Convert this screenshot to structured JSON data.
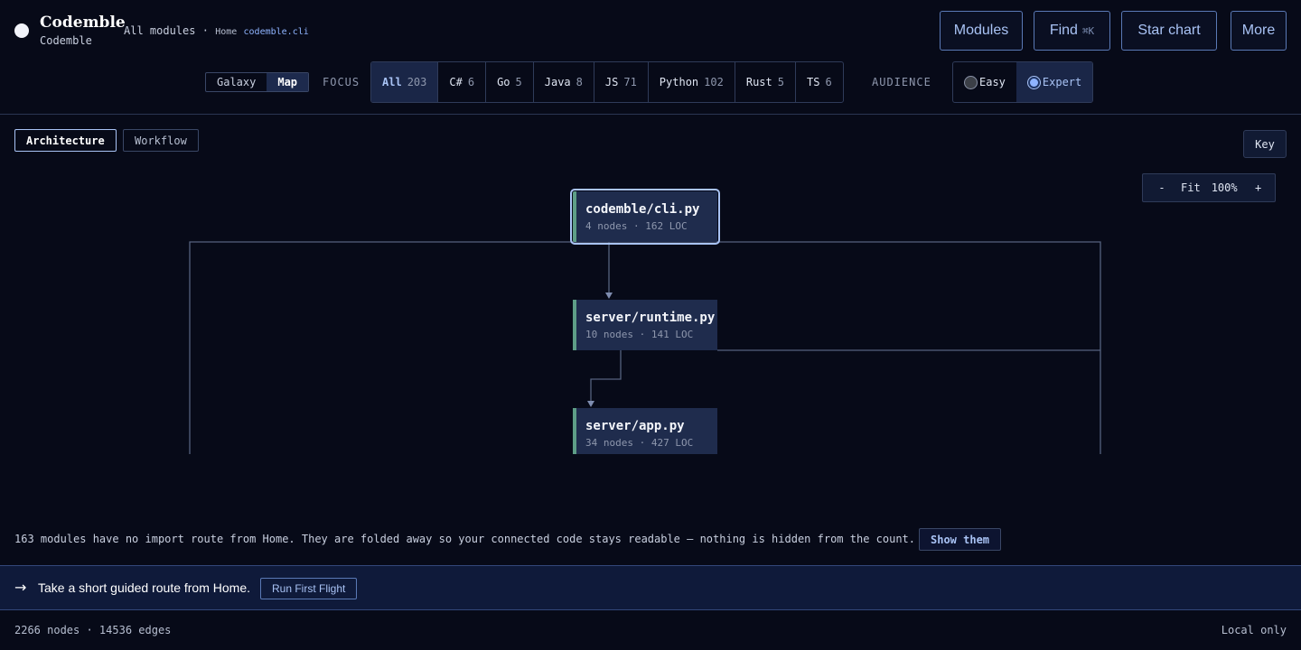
{
  "brand": {
    "title": "Codemble",
    "subtitle": "Codemble"
  },
  "breadcrumb": {
    "root": "All modules",
    "sep": "·",
    "home": "Home",
    "module": "codemble.cli"
  },
  "top_buttons": {
    "modules": "Modules",
    "find": "Find",
    "find_kbd": "⌘K",
    "star_chart": "Star chart",
    "more": "More"
  },
  "view_toggle": [
    {
      "label": "Galaxy",
      "active": false
    },
    {
      "label": "Map",
      "active": true
    }
  ],
  "focus": {
    "label": "FOCUS",
    "filters": [
      {
        "label": "All",
        "count": "203",
        "active": true
      },
      {
        "label": "C#",
        "count": "6"
      },
      {
        "label": "Go",
        "count": "5"
      },
      {
        "label": "Java",
        "count": "8"
      },
      {
        "label": "JS",
        "count": "71"
      },
      {
        "label": "Python",
        "count": "102"
      },
      {
        "label": "Rust",
        "count": "5"
      },
      {
        "label": "TS",
        "count": "6"
      }
    ]
  },
  "audience": {
    "label": "AUDIENCE",
    "options": [
      {
        "label": "Easy",
        "selected": false
      },
      {
        "label": "Expert",
        "selected": true
      }
    ]
  },
  "tabs": [
    {
      "label": "Architecture",
      "active": true
    },
    {
      "label": "Workflow",
      "active": false
    }
  ],
  "key_button": "Key",
  "zoom": {
    "minus": "-",
    "fit": "Fit",
    "level": "100%",
    "plus": "+"
  },
  "nodes": [
    {
      "title": "codemble/cli.py",
      "meta": "4 nodes · 162 LOC",
      "selected": true
    },
    {
      "title": "server/runtime.py",
      "meta": "10 nodes · 141 LOC"
    },
    {
      "title": "server/app.py",
      "meta": "34 nodes · 427 LOC"
    }
  ],
  "notice": {
    "text": "163 modules have no import route from Home. They are folded away so your connected code stays readable — nothing is hidden from the count.",
    "button": "Show them"
  },
  "banner": {
    "arrow": "→",
    "text": "Take a short guided route from Home.",
    "button": "Run First Flight"
  },
  "footer": {
    "stats": "2266 nodes · 14536 edges",
    "mode": "Local only"
  },
  "colors": {
    "background": "#070a18",
    "accent": "#a9c3f5",
    "node_fill": "#1f2c4d",
    "node_stripe": "#5e9e87"
  }
}
